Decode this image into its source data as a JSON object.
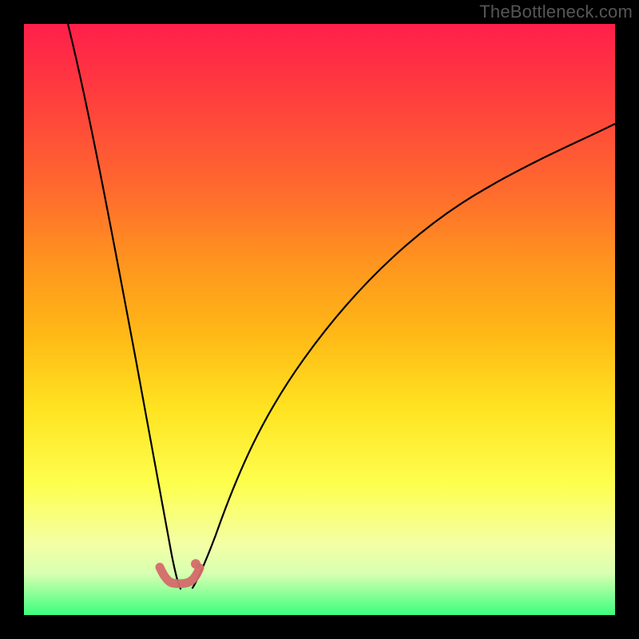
{
  "watermark": "TheBottleneck.com",
  "colors": {
    "frame_bg": "#000000",
    "gradient_top": "#ff1f4a",
    "gradient_bottom": "#3bff7d",
    "curve_stroke": "#000000",
    "marker_stroke": "#d46a6a"
  },
  "chart_data": {
    "type": "line",
    "title": "",
    "xlabel": "",
    "ylabel": "",
    "xlim": [
      0,
      100
    ],
    "ylim": [
      0,
      100
    ],
    "grid": false,
    "note": "No axes or tick labels are visible; values below are estimated from pixel positions on a 0–100 normalized scale (y=0 at bottom, y=100 at top).",
    "series": [
      {
        "name": "left_curve",
        "x": [
          7.4,
          9.1,
          10.8,
          12.5,
          14.2,
          15.9,
          17.6,
          19.3,
          20.9,
          22.6,
          24.3,
          25.7
        ],
        "y": [
          100,
          89.2,
          78.1,
          66.6,
          54.7,
          42.7,
          30.8,
          19.6,
          10.3,
          4.9,
          3.4,
          3.9
        ]
      },
      {
        "name": "right_curve",
        "x": [
          28.4,
          29.7,
          32.4,
          36.5,
          40.5,
          47.3,
          54.1,
          60.8,
          67.6,
          74.3,
          81.1,
          87.8,
          94.6,
          100
        ],
        "y": [
          4.6,
          5.4,
          10.5,
          20.8,
          30.0,
          43.4,
          54.3,
          63.0,
          69.9,
          75.0,
          78.6,
          81.1,
          82.4,
          83.1
        ]
      }
    ],
    "markers": {
      "name": "highlight_cluster",
      "points_xy": [
        [
          23.0,
          8.1
        ],
        [
          25.0,
          5.9
        ],
        [
          27.7,
          5.5
        ],
        [
          29.6,
          8.0
        ]
      ],
      "extra_dot_xy": [
        29.1,
        8.6
      ]
    }
  }
}
